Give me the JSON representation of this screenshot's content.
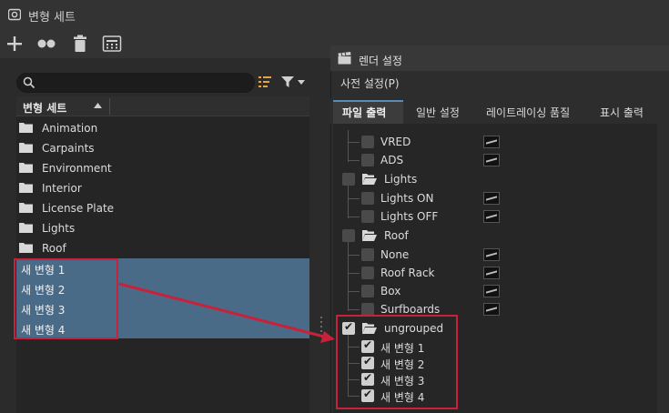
{
  "window": {
    "title": "변형 세트"
  },
  "toolbar": {
    "icons": [
      "plus-icon",
      "variants-icon",
      "trash-icon",
      "calculator-icon"
    ]
  },
  "left": {
    "column_header": "변형 세트",
    "folders": [
      "Animation",
      "Carpaints",
      "Environment",
      "Interior",
      "License Plate",
      "Lights",
      "Roof"
    ],
    "new_variants": [
      "새 변형 1",
      "새 변형 2",
      "새 변형 3",
      "새 변형 4"
    ]
  },
  "dialog": {
    "title": "렌더 설정",
    "presets": "사전 설정(P)",
    "tabs": [
      "파일 출력",
      "일반 설정",
      "레이트레이싱 품질",
      "표시 출력"
    ],
    "tree": {
      "items_top": [
        "VRED",
        "ADS"
      ],
      "lights_group": "Lights",
      "lights_items": [
        "Lights ON",
        "Lights OFF"
      ],
      "roof_group": "Roof",
      "roof_items": [
        "None",
        "Roof Rack",
        "Box",
        "Surfboards"
      ],
      "ungrouped_group": "ungrouped",
      "ungrouped_items": [
        "새 변형 1",
        "새 변형 2",
        "새 변형 3",
        "새 변형 4"
      ]
    }
  },
  "colors": {
    "selection": "#4a6b88",
    "highlight": "#c8223a",
    "tab_accent": "#5a8bb5"
  }
}
